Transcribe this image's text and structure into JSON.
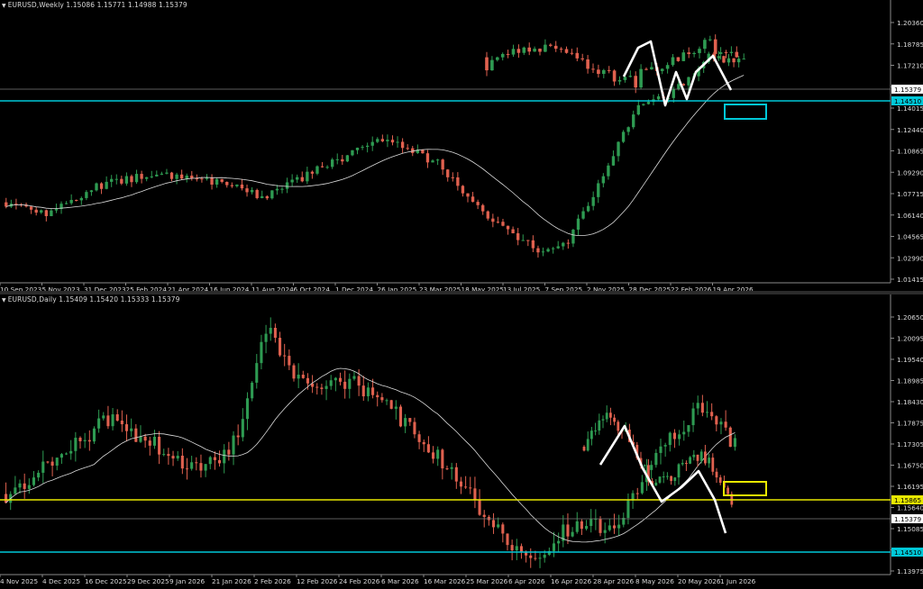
{
  "colors": {
    "background": "#000000",
    "bull": "#2e9b52",
    "bear": "#e0614f",
    "ma": "#dcdcdc",
    "grid_text": "#d8d8d8",
    "cyan": "#00c8d8",
    "yellow": "#e8e800",
    "white_pattern": "#ffffff",
    "price_box_bg": "#ffffff",
    "price_box_text": "#000000"
  },
  "icons": {
    "pane_collapse": "triangle-down-icon"
  },
  "weekly": {
    "title": "EURUSD,Weekly  1.15086 1.15771 1.14988 1.15379",
    "y_ticks": [
      "1.20360",
      "1.18785",
      "1.17210",
      "1.15635",
      "1.14015",
      "1.12440",
      "1.10865",
      "1.09290",
      "1.07715",
      "1.06140",
      "1.04565",
      "1.02990",
      "1.01415"
    ],
    "x_ticks": [
      "10 Sep 2023",
      "5 Nov 2023",
      "31 Dec 2023",
      "25 Feb 2024",
      "21 Apr 2024",
      "16 Jun 2024",
      "11 Aug 2024",
      "6 Oct 2024",
      "1 Dec 2024",
      "26 Jan 2025",
      "23 Mar 2025",
      "18 May 2025",
      "13 Jul 2025",
      "7 Sep 2025",
      "2 Nov 2025",
      "28 Dec 2025",
      "22 Feb 2026",
      "19 Apr 2026"
    ],
    "current_price": "1.15379",
    "support_price": "1.14510"
  },
  "daily": {
    "title": "EURUSD,Daily  1.15409 1.15420 1.15333 1.15379",
    "y_ticks": [
      "1.20650",
      "1.20095",
      "1.19540",
      "1.18985",
      "1.18430",
      "1.17875",
      "1.17305",
      "1.16750",
      "1.16195",
      "1.15640",
      "1.15085",
      "1.14530",
      "1.13975"
    ],
    "x_ticks": [
      "4 Nov 2025",
      "4 Dec 2025",
      "16 Dec 2025",
      "29 Dec 2025",
      "9 Jan 2026",
      "21 Jan 2026",
      "2 Feb 2026",
      "12 Feb 2026",
      "24 Feb 2026",
      "6 Mar 2026",
      "16 Mar 2026",
      "25 Mar 2026",
      "6 Apr 2026",
      "16 Apr 2026",
      "28 Apr 2026",
      "8 May 2026",
      "20 May 2026",
      "1 Jun 2026"
    ],
    "current_price": "1.15379",
    "resistance_price": "1.15865",
    "support_price": "1.14510"
  },
  "chart_data": [
    {
      "type": "candlestick",
      "title": "EURUSD,Weekly",
      "ylim": [
        1.0125,
        1.2075
      ],
      "current_price": 1.15379,
      "support_line": 1.1451,
      "series": [
        {
          "name": "EURUSD",
          "values": []
        }
      ]
    },
    {
      "type": "candlestick",
      "title": "EURUSD,Daily",
      "ylim": [
        1.1375,
        1.2087
      ],
      "current_price": 1.15379,
      "support_line": 1.1451,
      "resistance_line": 1.15865,
      "series": [
        {
          "name": "EURUSD",
          "values": []
        }
      ]
    }
  ]
}
